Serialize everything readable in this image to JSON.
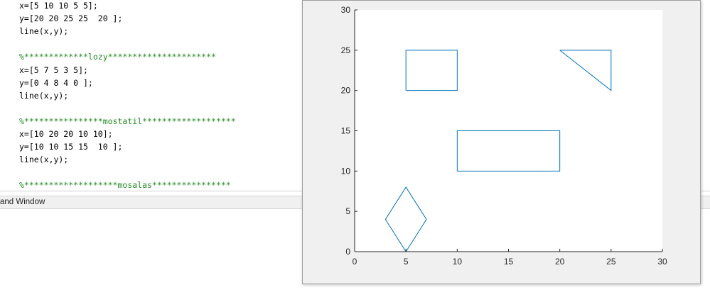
{
  "editor": {
    "lines": [
      {
        "text": "x=[5 10 10 5 5];",
        "type": "code"
      },
      {
        "text": "y=[20 20 25 25  20 ];",
        "type": "code"
      },
      {
        "text": "line(x,y);",
        "type": "code"
      },
      {
        "text": "",
        "type": "code"
      },
      {
        "text": "%*************lozy**********************",
        "type": "comment"
      },
      {
        "text": "x=[5 7 5 3 5];",
        "type": "code"
      },
      {
        "text": "y=[0 4 8 4 0 ];",
        "type": "code"
      },
      {
        "text": "line(x,y);",
        "type": "code"
      },
      {
        "text": "",
        "type": "code"
      },
      {
        "text": "%****************mostatil*******************",
        "type": "comment"
      },
      {
        "text": "x=[10 20 20 10 10];",
        "type": "code"
      },
      {
        "text": "y=[10 10 15 15  10 ];",
        "type": "code"
      },
      {
        "text": "line(x,y);",
        "type": "code"
      },
      {
        "text": "",
        "type": "code"
      },
      {
        "text": "%*******************mosalas****************",
        "type": "comment"
      }
    ]
  },
  "command_window": {
    "title": "and Window"
  },
  "chart_data": {
    "type": "line",
    "xlim": [
      0,
      30
    ],
    "ylim": [
      0,
      30
    ],
    "xticks": [
      0,
      5,
      10,
      15,
      20,
      25,
      30
    ],
    "yticks": [
      0,
      5,
      10,
      15,
      20,
      25,
      30
    ],
    "grid": false,
    "line_color": "#0072bd",
    "series": [
      {
        "x": [
          5,
          10,
          10,
          5,
          5
        ],
        "y": [
          20,
          20,
          25,
          25,
          20
        ]
      },
      {
        "x": [
          5,
          7,
          5,
          3,
          5
        ],
        "y": [
          0,
          4,
          8,
          4,
          0
        ]
      },
      {
        "x": [
          10,
          20,
          20,
          10,
          10
        ],
        "y": [
          10,
          10,
          15,
          15,
          10
        ]
      },
      {
        "x": [
          20,
          25,
          25,
          20
        ],
        "y": [
          25,
          25,
          20,
          25
        ]
      }
    ]
  }
}
